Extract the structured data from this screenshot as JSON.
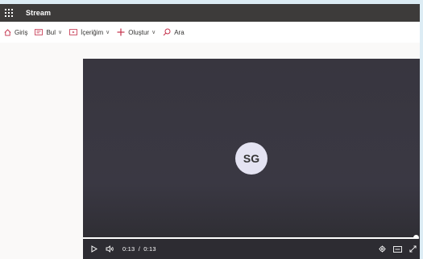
{
  "app": {
    "title": "Stream"
  },
  "nav": {
    "home": "Giriş",
    "discover": "Bul",
    "content": "İçeriğim",
    "create": "Oluştur",
    "search": "Ara"
  },
  "player": {
    "avatar_initials": "SG",
    "time_current": "0:13",
    "time_separator": "/",
    "time_total": "0:13",
    "progress": 1.0
  },
  "colors": {
    "topbar": "#3d3b3a",
    "accent": "#c4314b",
    "player_bg": "#38373f"
  }
}
